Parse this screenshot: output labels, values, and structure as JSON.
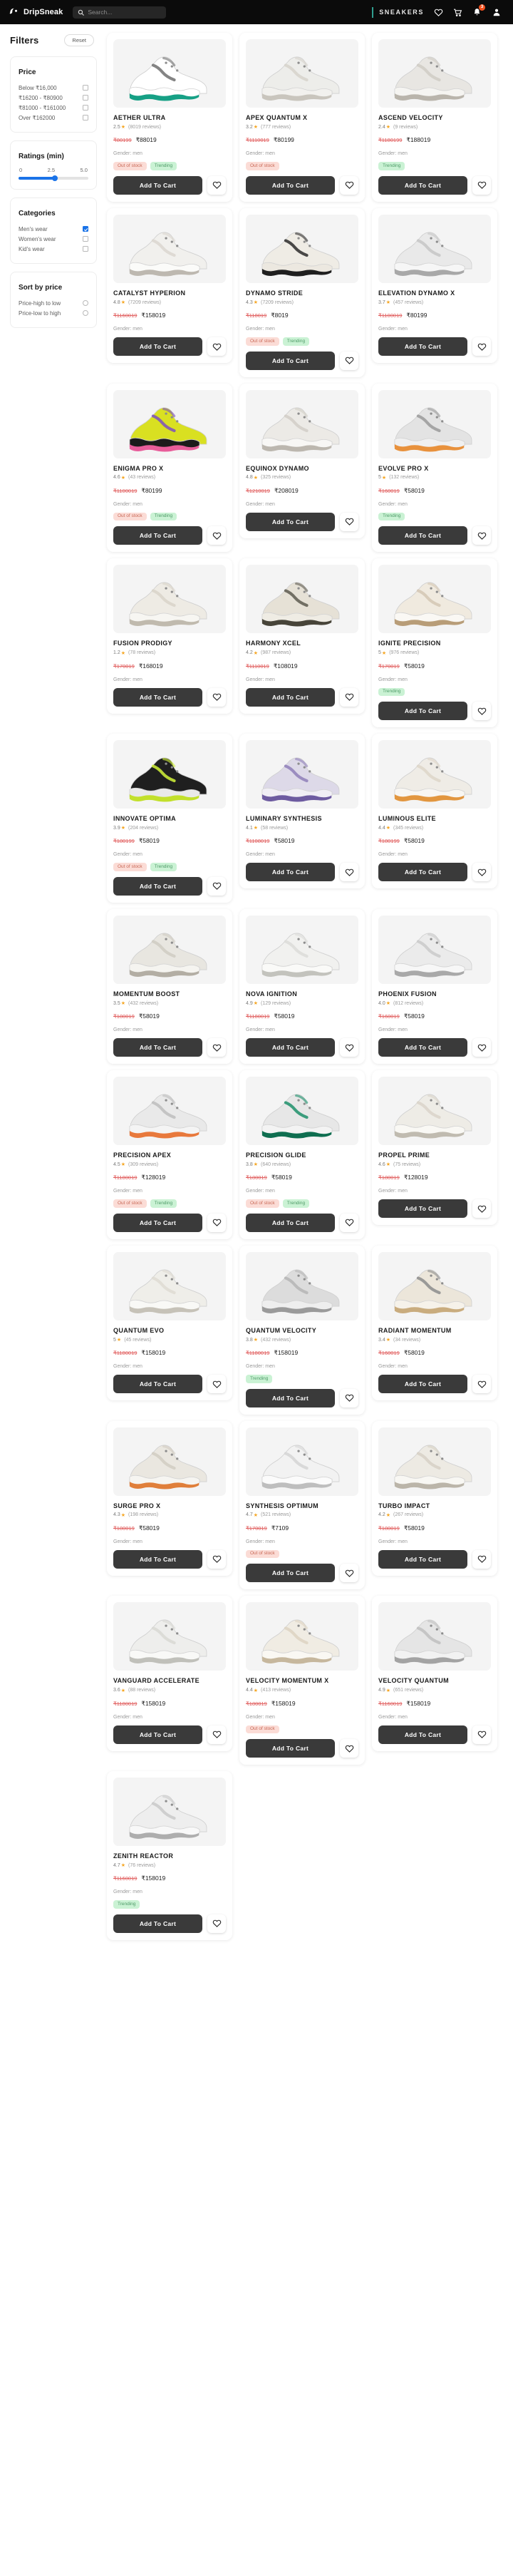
{
  "header": {
    "brand": "DripSneak",
    "logo_icon": "droplet-logo-icon",
    "search": {
      "placeholder": "Search...",
      "value": "",
      "icon": "search-icon"
    },
    "category_label": "SNEAKERS",
    "icons": {
      "wishlist": "heart-icon",
      "cart": "shopping-cart-icon",
      "notifications": "bell-icon",
      "profile": "user-avatar-icon"
    },
    "notification_count": "3",
    "accent_color": "#2f9e8f",
    "badge_color": "#f4511e"
  },
  "sidebar": {
    "title": "Filters",
    "reset_label": "Reset",
    "price": {
      "title": "Price",
      "options": [
        {
          "label": "Below ₹16,000",
          "checked": false
        },
        {
          "label": "₹16200 - ₹80900",
          "checked": false
        },
        {
          "label": "₹81000 - ₹161000",
          "checked": false
        },
        {
          "label": "Over ₹162000",
          "checked": false
        }
      ]
    },
    "ratings": {
      "title": "Ratings (min)",
      "ticks": [
        "0",
        "2.5",
        "5.0"
      ],
      "value": 2.6,
      "min": 0,
      "max": 5
    },
    "categories": {
      "title": "Categories",
      "options": [
        {
          "label": "Men's wear",
          "checked": true
        },
        {
          "label": "Women's wear",
          "checked": false
        },
        {
          "label": "Kid's wear",
          "checked": false
        }
      ]
    },
    "sort": {
      "title": "Sort by price",
      "options": [
        {
          "label": "Price-high to low",
          "selected": false
        },
        {
          "label": "Price-low to high",
          "selected": false
        }
      ]
    }
  },
  "product_labels": {
    "add_to_cart": "Add To Cart",
    "wishlist_icon": "heart-outline-icon",
    "gender_prefix": "Gender: ",
    "reviews_suffix": " reviews)",
    "star_icon": "star-icon",
    "out_of_stock": "Out of stock",
    "trending": "Trending"
  },
  "products": [
    {
      "name": "AETHER ULTRA",
      "rating": "2.5",
      "reviews": "(8019 reviews)",
      "old_price": "₹80199",
      "price": "₹88019",
      "gender": "Gender: men",
      "tags": [
        "Out of stock",
        "Trending"
      ],
      "shoe": {
        "body": "#ffffff",
        "mid": "#6e6e6e",
        "sole": "#ffffff",
        "accent": "#16a085"
      }
    },
    {
      "name": "APEX QUANTUM X",
      "rating": "3.2",
      "reviews": "(777 reviews)",
      "old_price": "₹1110019",
      "price": "₹80199",
      "gender": "Gender: men",
      "tags": [
        "Out of stock"
      ],
      "shoe": {
        "body": "#ededea",
        "mid": "#d6d2cb",
        "sole": "#f2f1ee",
        "accent": "#c9c5bd"
      }
    },
    {
      "name": "ASCEND VELOCITY",
      "rating": "2.4",
      "reviews": "(9 reviews)",
      "old_price": "₹1180199",
      "price": "₹188019",
      "gender": "Gender: men",
      "tags": [
        "Trending"
      ],
      "shoe": {
        "body": "#e8e6e2",
        "mid": "#cfcbc4",
        "sole": "#f5f4f1",
        "accent": "#b9b4ab"
      }
    },
    {
      "name": "CATALYST HYPERION",
      "rating": "4.8",
      "reviews": "(7209 reviews)",
      "old_price": "₹1160019",
      "price": "₹158019",
      "gender": "Gender: men",
      "tags": [],
      "shoe": {
        "body": "#f1f0ed",
        "mid": "#dad6cf",
        "sole": "#fbfbf9",
        "accent": "#bdb8b0"
      }
    },
    {
      "name": "DYNAMO STRIDE",
      "rating": "4.3",
      "reviews": "(7209 reviews)",
      "old_price": "₹118019",
      "price": "₹8019",
      "gender": "Gender: men",
      "tags": [
        "Out of stock",
        "Trending"
      ],
      "shoe": {
        "body": "#efece5",
        "mid": "#2b2b2b",
        "sole": "#ece8e0",
        "accent": "#1f1f1f"
      }
    },
    {
      "name": "ELEVATION DYNAMO X",
      "rating": "3.7",
      "reviews": "(457 reviews)",
      "old_price": "₹1100019",
      "price": "₹80199",
      "gender": "Gender: men",
      "tags": [],
      "shoe": {
        "body": "#e9e9e9",
        "mid": "#c6c6c6",
        "sole": "#f6f6f6",
        "accent": "#a8a8a8"
      }
    },
    {
      "name": "ENIGMA PRO X",
      "rating": "4.6",
      "reviews": "(43 reviews)",
      "old_price": "₹1100019",
      "price": "₹80199",
      "gender": "Gender: men",
      "tags": [
        "Out of stock",
        "Trending"
      ],
      "shoe": {
        "body": "#d9e021",
        "mid": "#7b4fc0",
        "sole": "#1b1b1b",
        "accent": "#e85d9a"
      }
    },
    {
      "name": "EQUINOX DYNAMO",
      "rating": "4.8",
      "reviews": "(325 reviews)",
      "old_price": "₹1210019",
      "price": "₹208019",
      "gender": "Gender: men",
      "tags": [],
      "shoe": {
        "body": "#eceae6",
        "mid": "#d2cec7",
        "sole": "#f8f7f5",
        "accent": "#bcb7af"
      }
    },
    {
      "name": "EVOLVE PRO X",
      "rating": "5",
      "reviews": "(132 reviews)",
      "old_price": "₹160019",
      "price": "₹58019",
      "gender": "Gender: men",
      "tags": [
        "Trending"
      ],
      "shoe": {
        "body": "#e3e3e3",
        "mid": "#9a9a9a",
        "sole": "#f0f0f0",
        "accent": "#e8913c"
      }
    },
    {
      "name": "FUSION PRODIGY",
      "rating": "1.2",
      "reviews": "(78 reviews)",
      "old_price": "₹170019",
      "price": "₹168019",
      "gender": "Gender: men",
      "tags": [],
      "shoe": {
        "body": "#eeebe4",
        "mid": "#d8d3c9",
        "sole": "#f7f6f2",
        "accent": "#c0baae"
      }
    },
    {
      "name": "HARMONY XCEL",
      "rating": "4.2",
      "reviews": "(987 reviews)",
      "old_price": "₹1110019",
      "price": "₹108019",
      "gender": "Gender: men",
      "tags": [],
      "shoe": {
        "body": "#e6e1d6",
        "mid": "#5d5a50",
        "sole": "#efece4",
        "accent": "#474439"
      }
    },
    {
      "name": "IGNITE PRECISION",
      "rating": "5",
      "reviews": "(976 reviews)",
      "old_price": "₹170019",
      "price": "₹58019",
      "gender": "Gender: men",
      "tags": [
        "Trending"
      ],
      "shoe": {
        "body": "#f0eadf",
        "mid": "#d3c7b4",
        "sole": "#faf8f4",
        "accent": "#b89d78"
      }
    },
    {
      "name": "INNOVATE OPTIMA",
      "rating": "3.9",
      "reviews": "(204 reviews)",
      "old_price": "₹180199",
      "price": "₹58019",
      "gender": "Gender: men",
      "tags": [
        "Out of stock",
        "Trending"
      ],
      "shoe": {
        "body": "#1f1f1f",
        "mid": "#d4f53a",
        "sole": "#e9e9e9",
        "accent": "#c2e02b"
      }
    },
    {
      "name": "LUMINARY SYNTHESIS",
      "rating": "4.1",
      "reviews": "(58 reviews)",
      "old_price": "₹1108019",
      "price": "₹58019",
      "gender": "Gender: men",
      "tags": [],
      "shoe": {
        "body": "#ddd9e8",
        "mid": "#8f7fb8",
        "sole": "#f0eef5",
        "accent": "#6d5ba0"
      }
    },
    {
      "name": "LUMINOUS ELITE",
      "rating": "4.4",
      "reviews": "(345 reviews)",
      "old_price": "₹180199",
      "price": "₹58019",
      "gender": "Gender: men",
      "tags": [],
      "shoe": {
        "body": "#efece6",
        "mid": "#ddd6c8",
        "sole": "#f8f6f2",
        "accent": "#e2963f"
      }
    },
    {
      "name": "MOMENTUM BOOST",
      "rating": "3.5",
      "reviews": "(432 reviews)",
      "old_price": "₹180019",
      "price": "₹58019",
      "gender": "Gender: men",
      "tags": [],
      "shoe": {
        "body": "#e8e6e0",
        "mid": "#cfcbc2",
        "sole": "#f5f4f0",
        "accent": "#b3aea4"
      }
    },
    {
      "name": "NOVA IGNITION",
      "rating": "4.9",
      "reviews": "(129 reviews)",
      "old_price": "₹1180019",
      "price": "₹58019",
      "gender": "Gender: men",
      "tags": [],
      "shoe": {
        "body": "#f1f1ef",
        "mid": "#dcdcd8",
        "sole": "#fafaf8",
        "accent": "#c3c3bd"
      }
    },
    {
      "name": "PHOENIX FUSION",
      "rating": "4.0",
      "reviews": "(812 reviews)",
      "old_price": "₹160019",
      "price": "₹58019",
      "gender": "Gender: men",
      "tags": [],
      "shoe": {
        "body": "#ebebeb",
        "mid": "#cacaca",
        "sole": "#f7f7f7",
        "accent": "#a9a9a9"
      }
    },
    {
      "name": "PRECISION APEX",
      "rating": "4.5",
      "reviews": "(309 reviews)",
      "old_price": "₹1180019",
      "price": "₹128019",
      "gender": "Gender: men",
      "tags": [
        "Out of stock",
        "Trending"
      ],
      "shoe": {
        "body": "#e9e9e9",
        "mid": "#bdbdbd",
        "sole": "#f4f4f4",
        "accent": "#e8793c"
      }
    },
    {
      "name": "PRECISION GLIDE",
      "rating": "3.8",
      "reviews": "(640 reviews)",
      "old_price": "₹180019",
      "price": "₹58019",
      "gender": "Gender: men",
      "tags": [
        "Out of stock",
        "Trending"
      ],
      "shoe": {
        "body": "#e7e7e7",
        "mid": "#1d8f6a",
        "sole": "#f3f3f3",
        "accent": "#0f6e50"
      }
    },
    {
      "name": "PROPEL PRIME",
      "rating": "4.6",
      "reviews": "(75 reviews)",
      "old_price": "₹180019",
      "price": "₹128019",
      "gender": "Gender: men",
      "tags": [],
      "shoe": {
        "body": "#eeece6",
        "mid": "#d9d4c9",
        "sole": "#f9f8f4",
        "accent": "#c0bbb0"
      }
    },
    {
      "name": "QUANTUM EVO",
      "rating": "5",
      "reviews": "(45 reviews)",
      "old_price": "₹1180019",
      "price": "₹158019",
      "gender": "Gender: men",
      "tags": [],
      "shoe": {
        "body": "#efeee9",
        "mid": "#dedbd2",
        "sole": "#f9f9f6",
        "accent": "#c6c2b8"
      }
    },
    {
      "name": "QUANTUM VELOCITY",
      "rating": "3.8",
      "reviews": "(432 reviews)",
      "old_price": "₹1180019",
      "price": "₹158019",
      "gender": "Gender: men",
      "tags": [
        "Trending"
      ],
      "shoe": {
        "body": "#dcdcdc",
        "mid": "#b5b5b5",
        "sole": "#eeeeee",
        "accent": "#9a9a9a"
      }
    },
    {
      "name": "RADIANT MOMENTUM",
      "rating": "3.4",
      "reviews": "(34 reviews)",
      "old_price": "₹160019",
      "price": "₹58019",
      "gender": "Gender: men",
      "tags": [],
      "shoe": {
        "body": "#ece6da",
        "mid": "#8c8c8c",
        "sole": "#f6f2ea",
        "accent": "#c9ac7e"
      }
    },
    {
      "name": "SURGE PRO X",
      "rating": "4.3",
      "reviews": "(198 reviews)",
      "old_price": "₹180019",
      "price": "₹58019",
      "gender": "Gender: men",
      "tags": [],
      "shoe": {
        "body": "#eae7e0",
        "mid": "#d1ccc2",
        "sole": "#f6f5f1",
        "accent": "#e07f3a"
      }
    },
    {
      "name": "SYNTHESIS OPTIMUM",
      "rating": "4.7",
      "reviews": "(521 reviews)",
      "old_price": "₹170019",
      "price": "₹7109",
      "gender": "Gender: men",
      "tags": [
        "Out of stock"
      ],
      "shoe": {
        "body": "#f2f2f2",
        "mid": "#d5d5d5",
        "sole": "#fbfbfb",
        "accent": "#bebebe"
      }
    },
    {
      "name": "TURBO IMPACT",
      "rating": "4.2",
      "reviews": "(267 reviews)",
      "old_price": "₹180019",
      "price": "₹58019",
      "gender": "Gender: men",
      "tags": [],
      "shoe": {
        "body": "#edeae3",
        "mid": "#d6d0c5",
        "sole": "#f8f7f3",
        "accent": "#bbb5a9"
      }
    },
    {
      "name": "VANGUARD ACCELERATE",
      "rating": "3.6",
      "reviews": "(88 reviews)",
      "old_price": "₹1180019",
      "price": "₹158019",
      "gender": "Gender: men",
      "tags": [],
      "shoe": {
        "body": "#eeeeec",
        "mid": "#d8d8d4",
        "sole": "#f9f9f7",
        "accent": "#c0c0ba"
      }
    },
    {
      "name": "VELOCITY MOMENTUM X",
      "rating": "4.4",
      "reviews": "(413 reviews)",
      "old_price": "₹180019",
      "price": "₹158019",
      "gender": "Gender: men",
      "tags": [
        "Out of stock"
      ],
      "shoe": {
        "body": "#f0ece3",
        "mid": "#ddd3c2",
        "sole": "#faf8f3",
        "accent": "#c6b79d"
      }
    },
    {
      "name": "VELOCITY QUANTUM",
      "rating": "4.9",
      "reviews": "(651 reviews)",
      "old_price": "₹1160019",
      "price": "₹158019",
      "gender": "Gender: men",
      "tags": [],
      "shoe": {
        "body": "#e5e5e5",
        "mid": "#bfbfbf",
        "sole": "#f2f2f2",
        "accent": "#a3a3a3"
      }
    },
    {
      "name": "ZENITH REACTOR",
      "rating": "4.7",
      "reviews": "(76 reviews)",
      "old_price": "₹1160019",
      "price": "₹158019",
      "gender": "Gender: men",
      "tags": [
        "Trending"
      ],
      "shoe": {
        "body": "#eeeeee",
        "mid": "#c9c9c9",
        "sole": "#f8f8f8",
        "accent": "#aeaeae"
      }
    }
  ]
}
